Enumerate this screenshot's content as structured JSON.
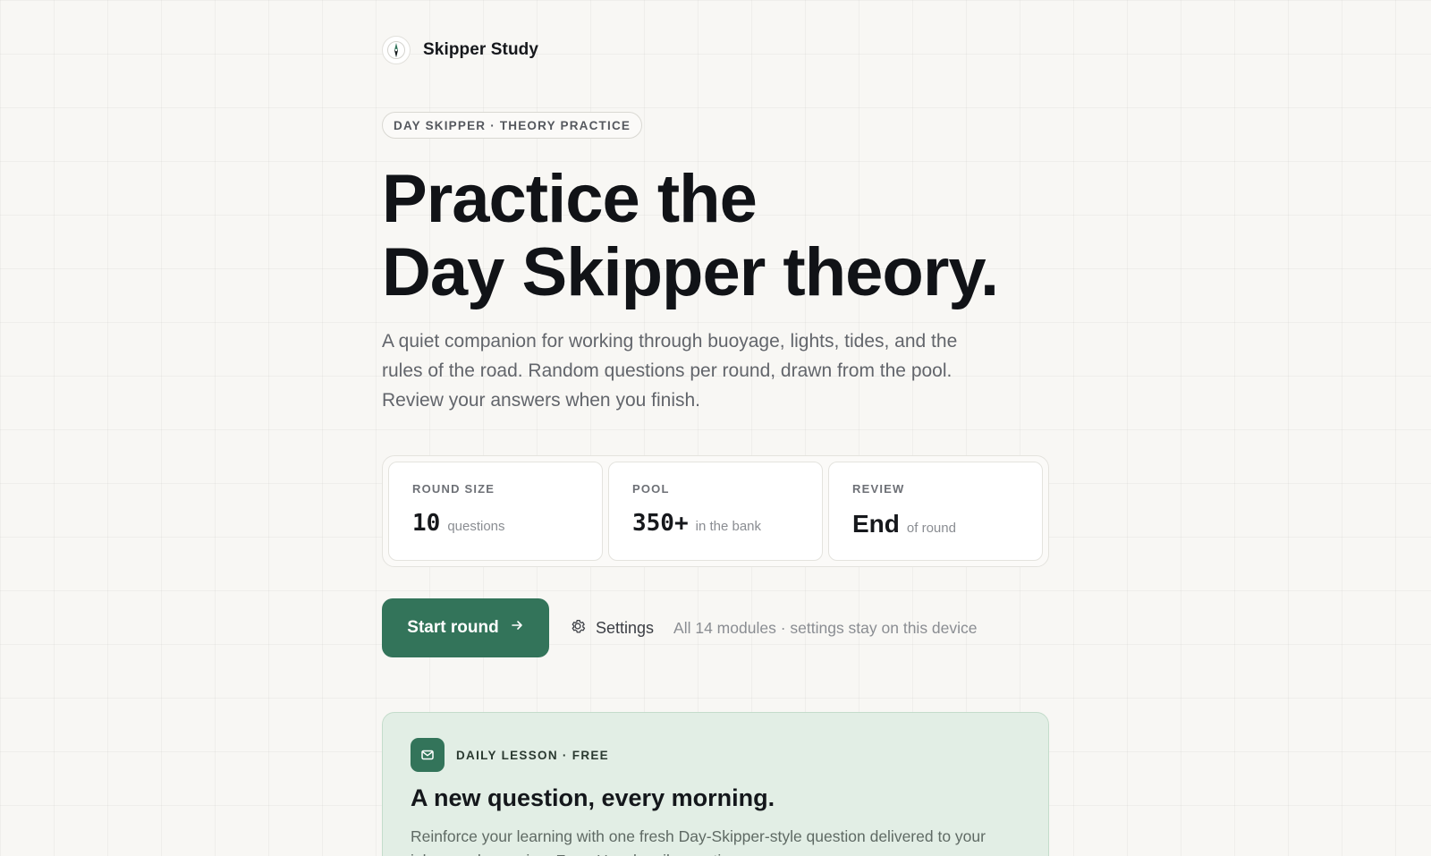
{
  "brand": {
    "name": "Skipper Study",
    "logo_icon": "compass-icon"
  },
  "hero": {
    "eyebrow": "DAY SKIPPER · THEORY PRACTICE",
    "title_line1": "Practice the",
    "title_line2": "Day Skipper theory.",
    "lede": "A quiet companion for working through buoyage, lights, tides, and the rules of the road. Random questions per round, drawn from the pool. Review your answers when you finish."
  },
  "stats": [
    {
      "label": "ROUND SIZE",
      "value": "10",
      "sub": "questions"
    },
    {
      "label": "POOL",
      "value": "350+",
      "sub": "in the bank"
    },
    {
      "label": "REVIEW",
      "value": "End",
      "sub": "of round"
    }
  ],
  "actions": {
    "start_label": "Start round",
    "start_icon": "arrow-right-icon",
    "settings_label": "Settings",
    "settings_icon": "gear-icon",
    "note": "All 14 modules · settings stay on this device"
  },
  "lesson": {
    "icon": "mail-icon",
    "tag": "DAILY LESSON · FREE",
    "title": "A new question, every morning.",
    "text": "Reinforce your learning with one fresh Day-Skipper-style question delivered to your inbox each morning. Free. Unsubscribe anytime."
  },
  "colors": {
    "accent": "#33745a",
    "background": "#f8f7f4",
    "lesson_bg": "#e2eee5"
  }
}
